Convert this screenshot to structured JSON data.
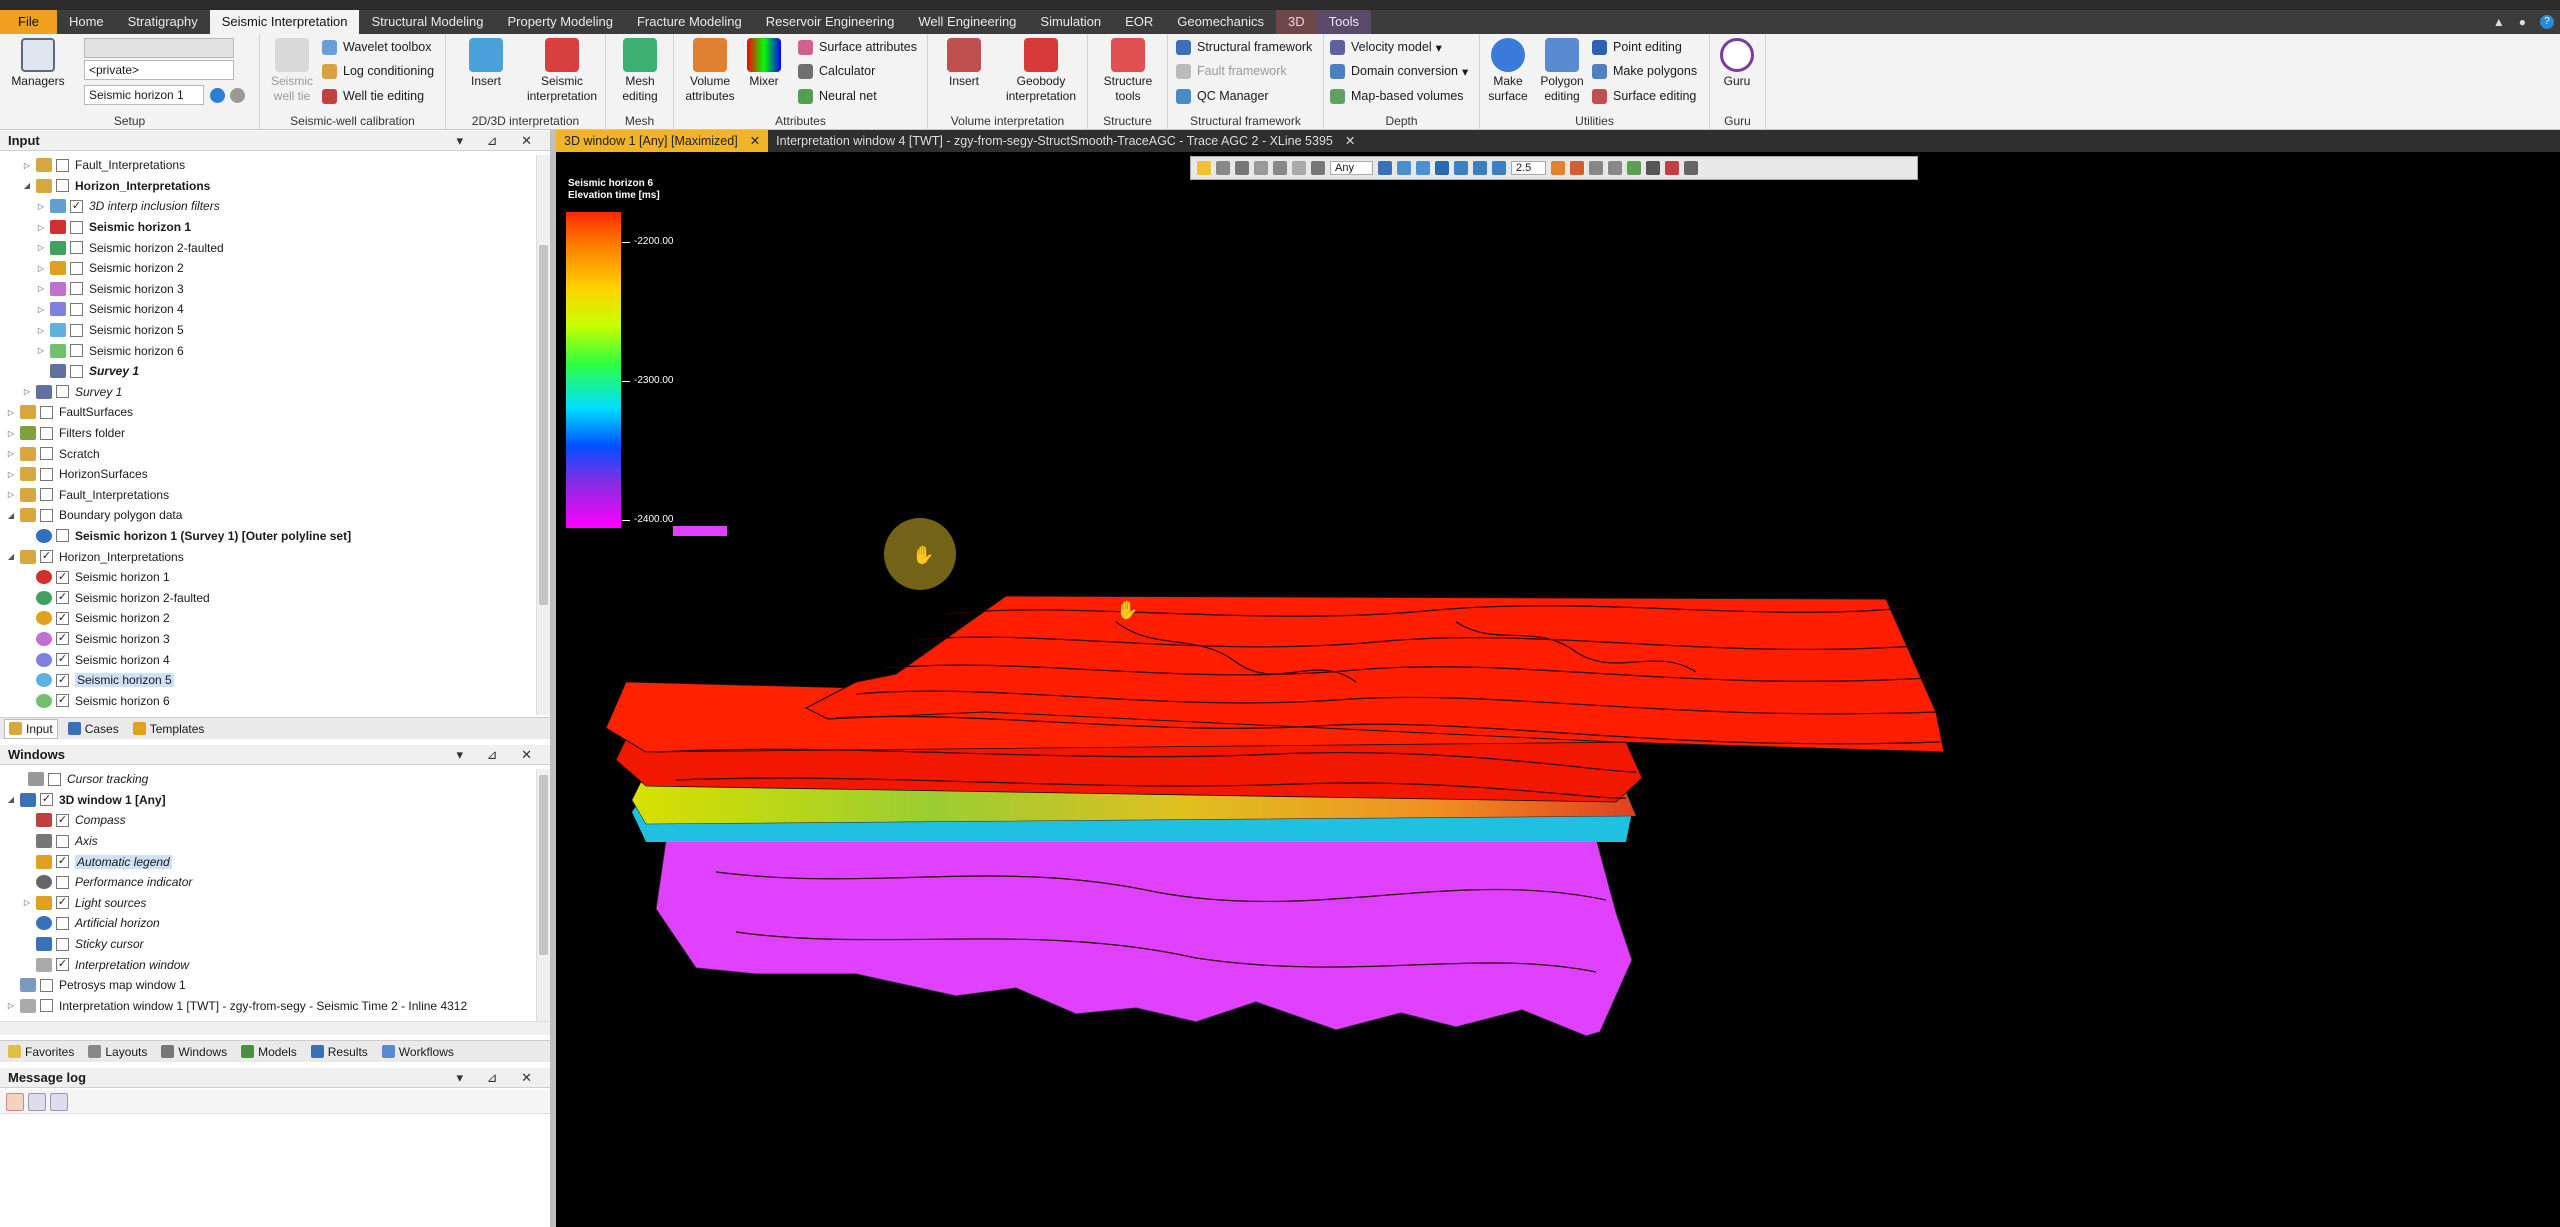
{
  "menubar": {
    "file": "File",
    "tabs": [
      "Home",
      "Stratigraphy",
      "Seismic Interpretation",
      "Structural Modeling",
      "Property Modeling",
      "Fracture Modeling",
      "Reservoir Engineering",
      "Well Engineering",
      "Simulation",
      "EOR",
      "Geomechanics"
    ],
    "active_tab": "Seismic Interpretation",
    "context_3d": "3D",
    "tools": "Tools"
  },
  "ribbon": {
    "setup": {
      "label": "Setup",
      "managers": "Managers",
      "private_combo": "<private>",
      "horizon_combo": "Seismic horizon 1"
    },
    "calibration": {
      "label": "Seismic-well calibration",
      "seismic_well_tie": "Seismic well tie",
      "wavelet_toolbox": "Wavelet toolbox",
      "log_conditioning": "Log conditioning",
      "well_tie_editing": "Well tie editing"
    },
    "interp": {
      "label": "2D/3D interpretation",
      "insert": "Insert",
      "seismic_interpretation": "Seismic interpretation"
    },
    "mesh": {
      "label": "Mesh",
      "mesh_editing": "Mesh editing"
    },
    "attributes": {
      "label": "Attributes",
      "volume_attributes": "Volume attributes",
      "mixer": "Mixer",
      "surface_attributes": "Surface attributes",
      "calculator": "Calculator",
      "neural_net": "Neural net"
    },
    "volume_interp": {
      "label": "Volume interpretation",
      "insert": "Insert",
      "geobody_interpretation": "Geobody interpretation"
    },
    "structure": {
      "label": "Structure",
      "structure_tools": "Structure tools"
    },
    "structural_framework": {
      "label": "Structural framework",
      "structural_framework": "Structural framework",
      "fault_framework": "Fault framework",
      "qc_manager": "QC Manager"
    },
    "depth": {
      "label": "Depth",
      "velocity_model": "Velocity model",
      "domain_conversion": "Domain conversion",
      "map_based_volumes": "Map-based volumes"
    },
    "utilities": {
      "label": "Utilities",
      "make_surface": "Make surface",
      "polygon_editing": "Polygon editing",
      "point_editing": "Point editing",
      "make_polygons": "Make polygons",
      "surface_editing": "Surface editing"
    },
    "guru": {
      "label": "Guru",
      "guru": "Guru"
    }
  },
  "input_panel": {
    "title": "Input",
    "items": [
      {
        "label": "Fault_Interpretations",
        "checked": false
      },
      {
        "label": "Horizon_Interpretations",
        "checked": false
      },
      {
        "label": "3D interp inclusion filters",
        "checked": true
      },
      {
        "label": "Seismic horizon 1",
        "checked": false
      },
      {
        "label": "Seismic horizon 2-faulted",
        "checked": false
      },
      {
        "label": "Seismic horizon 2",
        "checked": false
      },
      {
        "label": "Seismic horizon 3",
        "checked": false
      },
      {
        "label": "Seismic horizon 4",
        "checked": false
      },
      {
        "label": "Seismic horizon 5",
        "checked": false
      },
      {
        "label": "Seismic horizon 6",
        "checked": false
      },
      {
        "label": "Survey 1",
        "checked": false
      },
      {
        "label": "Survey 1",
        "checked": false
      },
      {
        "label": "FaultSurfaces",
        "checked": false
      },
      {
        "label": "Filters folder",
        "checked": false
      },
      {
        "label": "Scratch",
        "checked": false
      },
      {
        "label": "HorizonSurfaces",
        "checked": false
      },
      {
        "label": "Fault_Interpretations",
        "checked": false
      },
      {
        "label": "Boundary polygon data",
        "checked": false
      },
      {
        "label": "Seismic horizon 1 (Survey 1) [Outer polyline set]",
        "checked": false
      },
      {
        "label": "Horizon_Interpretations",
        "checked": true
      },
      {
        "label": "Seismic horizon 1",
        "checked": true
      },
      {
        "label": "Seismic horizon 2-faulted",
        "checked": true
      },
      {
        "label": "Seismic horizon 2",
        "checked": true
      },
      {
        "label": "Seismic horizon 3",
        "checked": true
      },
      {
        "label": "Seismic horizon 4",
        "checked": true
      },
      {
        "label": "Seismic horizon 5",
        "checked": true
      },
      {
        "label": "Seismic horizon 6",
        "checked": true
      }
    ],
    "tabs": [
      "Input",
      "Cases",
      "Templates"
    ]
  },
  "windows_panel": {
    "title": "Windows",
    "items": [
      {
        "label": "Cursor tracking",
        "checked": false
      },
      {
        "label": "3D window 1 [Any]",
        "checked": true
      },
      {
        "label": "Compass",
        "checked": true
      },
      {
        "label": "Axis",
        "checked": false
      },
      {
        "label": "Automatic legend",
        "checked": true
      },
      {
        "label": "Performance indicator",
        "checked": false
      },
      {
        "label": "Light sources",
        "checked": true
      },
      {
        "label": "Artificial horizon",
        "checked": false
      },
      {
        "label": "Sticky cursor",
        "checked": false
      },
      {
        "label": "Interpretation window",
        "checked": true
      },
      {
        "label": "Petrosys map window 1",
        "checked": false
      },
      {
        "label": "Interpretation window 1 [TWT] - zgy-from-segy - Seismic Time 2 - Inline 4312",
        "checked": false
      }
    ],
    "tabs": [
      "Favorites",
      "Layouts",
      "Windows",
      "Models",
      "Results",
      "Workflows"
    ]
  },
  "message_log": {
    "title": "Message log"
  },
  "doc_tabs": [
    "3D window 1 [Any] [Maximized]",
    "Interpretation window 4 [TWT] - zgy-from-segy-StructSmooth-TraceAGC - Trace AGC 2 - XLine 5395"
  ],
  "viewer_toolbar": {
    "domain": "Any",
    "zoom": "2.5"
  },
  "legend": {
    "title": "Seismic horizon 6",
    "subtitle": "Elevation time [ms]",
    "ticks": [
      "-2200.00",
      "-2300.00",
      "-2400.00"
    ]
  },
  "colors": {
    "menubar": "#3c3c3c",
    "file_tab": "#f0a020",
    "active_doc_tab": "#f0b428",
    "viewport_bg": "#000000",
    "horizon_red": "#ff1e00",
    "horizon_magenta": "#e040ff"
  }
}
